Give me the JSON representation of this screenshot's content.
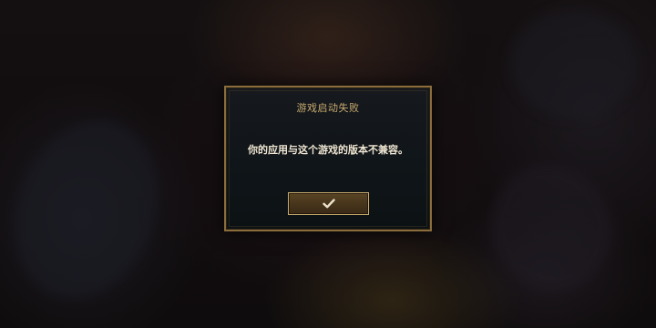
{
  "dialog": {
    "title": "游戏启动失败",
    "message": "你的应用与这个游戏的版本不兼容。",
    "confirm_icon": "checkmark-icon"
  },
  "colors": {
    "accent_gold": "#c8aa6e",
    "border_gold": "#8a6d3b",
    "text_light": "#f0e6d2",
    "button_fill": "#4a371d"
  }
}
